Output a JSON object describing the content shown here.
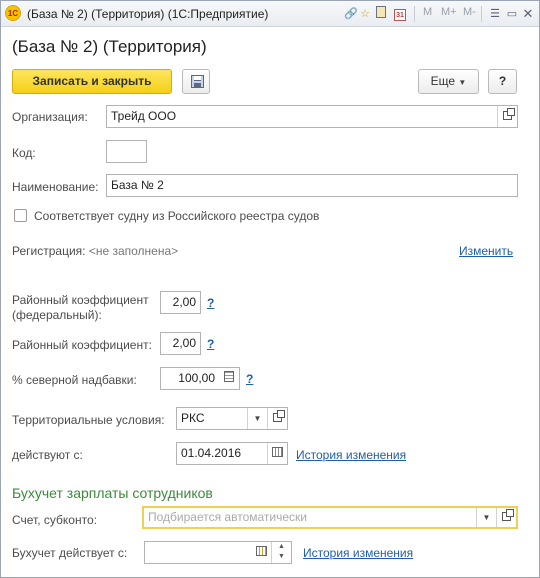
{
  "window": {
    "app_logo": "1С",
    "title": "(База № 2) (Территория)  (1С:Предприятие)",
    "toolbar": {
      "m": "M",
      "m_plus": "M+",
      "m_minus": "M-",
      "icons": [
        "link-icon",
        "favorite-star-icon",
        "calculator-icon",
        "calendar-icon",
        "menu-icon",
        "minimize-icon",
        "close-icon"
      ],
      "calendar_label": "31"
    }
  },
  "form": {
    "title": "(База № 2) (Территория)",
    "save_close_label": "Записать и закрыть",
    "more_label": "Еще",
    "help_label": "?",
    "organization": {
      "label": "Организация:",
      "value": "Трейд ООО"
    },
    "code": {
      "label": "Код:",
      "value": ""
    },
    "name": {
      "label": "Наименование:",
      "value": "База № 2"
    },
    "ship_register": {
      "label": "Соответствует судну из Российского реестра судов",
      "checked": false
    },
    "registration": {
      "label": "Регистрация:",
      "value": "<не заполнена>",
      "change_link": "Изменить"
    },
    "district_coef_federal": {
      "label_line1": "Районный коэффициент",
      "label_line2": "(федеральный):",
      "value": "2,00",
      "help": "?"
    },
    "district_coef": {
      "label": "Районный коэффициент:",
      "value": "2,00",
      "help": "?"
    },
    "north_allowance": {
      "label": "% северной надбавки:",
      "value": "100,00",
      "help": "?"
    },
    "territorial_conditions": {
      "label": "Территориальные условия:",
      "value": "РКС"
    },
    "effective_from": {
      "label": "действуют с:",
      "value": "01.04.2016",
      "history_link": "История изменения"
    },
    "payroll_section": {
      "title": "Бухучет зарплаты сотрудников",
      "account": {
        "label": "Счет, субконто:",
        "placeholder": "Подбирается автоматически"
      },
      "accounting_from": {
        "label": "Бухучет действует с:",
        "value": "",
        "history_link": "История изменения"
      }
    }
  }
}
